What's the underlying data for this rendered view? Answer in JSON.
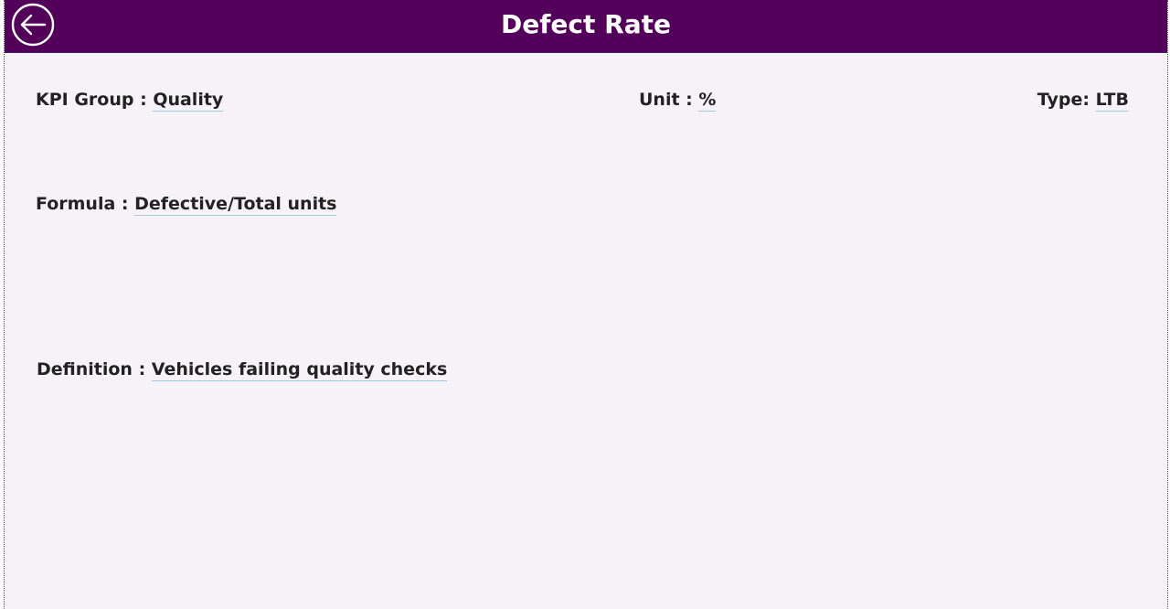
{
  "header": {
    "title": "Defect Rate",
    "back_icon": "arrow-left-circle-icon",
    "background_color": "#520059"
  },
  "fields": {
    "kpi_group_label": "KPI Group : ",
    "kpi_group_value": "Quality",
    "unit_label": "Unit : ",
    "unit_value": "%",
    "type_label": "Type: ",
    "type_value": "LTB",
    "formula_label": "Formula : ",
    "formula_value": "Defective/Total units",
    "definition_label": "Definition : ",
    "definition_value": "Vehicles failing quality checks"
  }
}
